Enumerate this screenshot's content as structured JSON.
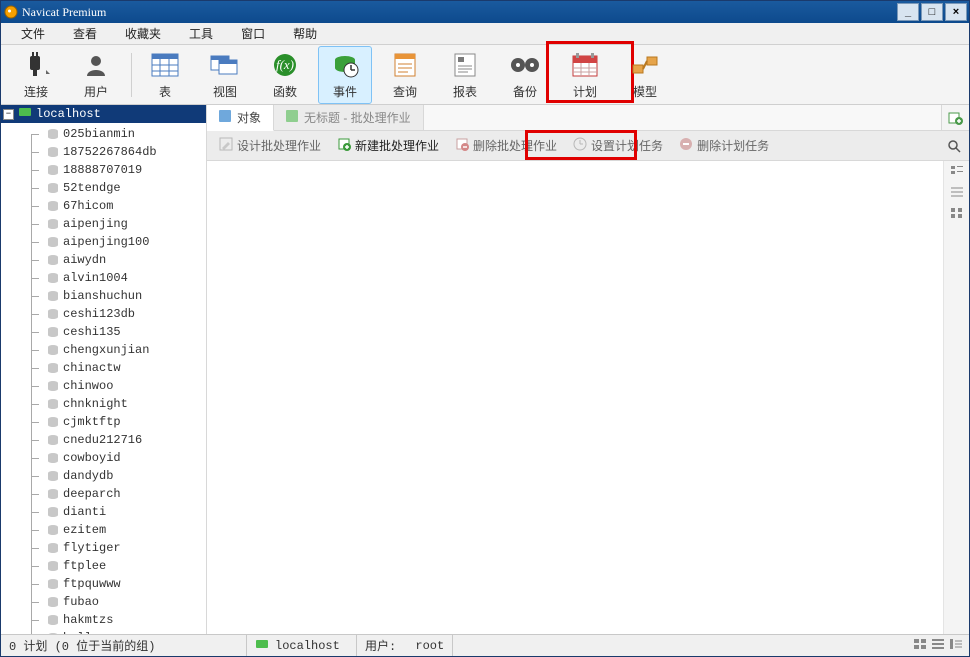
{
  "window": {
    "title": "Navicat Premium"
  },
  "winbtns": {
    "min": "_",
    "max": "□",
    "close": "×"
  },
  "menu": {
    "file": "文件",
    "view": "查看",
    "fav": "收藏夹",
    "tools": "工具",
    "window": "窗口",
    "help": "帮助"
  },
  "toolbar": {
    "connect": "连接",
    "user": "用户",
    "table": "表",
    "viewbtn": "视图",
    "func": "函数",
    "event": "事件",
    "query": "查询",
    "report": "报表",
    "backup": "备份",
    "plan": "计划",
    "model": "模型"
  },
  "tree": {
    "root": "localhost",
    "items": [
      "025bianmin",
      "18752267864db",
      "18888707019",
      "52tendge",
      "67hicom",
      "aipenjing",
      "aipenjing100",
      "aiwydn",
      "alvin1004",
      "bianshuchun",
      "ceshi123db",
      "ceshi135",
      "chengxunjian",
      "chinactw",
      "chinwoo",
      "chnknight",
      "cjmktftp",
      "cnedu212716",
      "cowboyid",
      "dandydb",
      "deeparch",
      "dianti",
      "ezitem",
      "flytiger",
      "ftplee",
      "ftpquwww",
      "fubao",
      "hakmtzs",
      "helloc"
    ]
  },
  "tabs": {
    "objects": "对象",
    "untitled": "无标题 - 批处理作业"
  },
  "actions": {
    "design": "设计批处理作业",
    "new": "新建批处理作业",
    "delete": "删除批处理作业",
    "settask": "设置计划任务",
    "deltask": "删除计划任务"
  },
  "status": {
    "left": "0 计划 (0 位于当前的组)",
    "conn": "localhost",
    "userlabel": "用户:",
    "user": "root"
  }
}
